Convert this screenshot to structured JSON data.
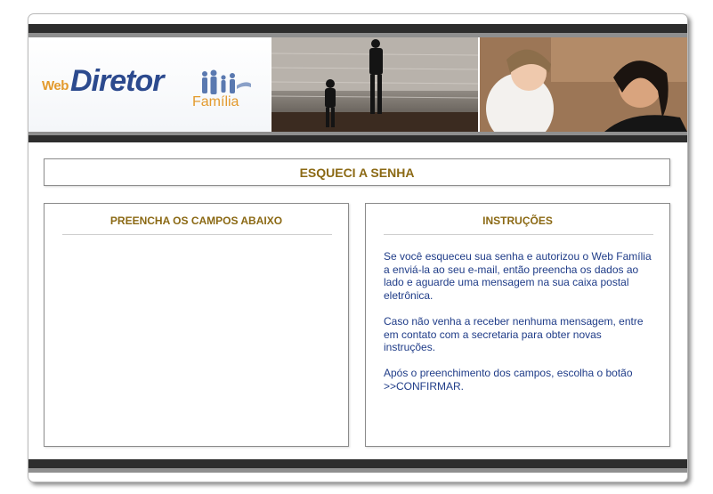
{
  "logo": {
    "web": "Web",
    "diretor": "Diretor",
    "familia": "Família"
  },
  "page_title": "ESQUECI A SENHA",
  "form_panel": {
    "title": "PREENCHA OS CAMPOS ABAIXO"
  },
  "instructions_panel": {
    "title": "INSTRUÇÕES",
    "paragraphs": [
      "Se você esqueceu sua senha e autorizou o Web Família a enviá-la ao seu e-mail, então preencha os dados ao lado e aguarde uma mensagem na sua caixa postal eletrônica.",
      "Caso não venha a receber nenhuma mensagem, entre em contato com a secretaria para obter novas instruções.",
      "Após o preenchimento dos campos, escolha o botão >>CONFIRMAR."
    ]
  },
  "colors": {
    "heading": "#8b6914",
    "body_text": "#1f3c88",
    "bar_dark": "#2d2d2d",
    "bar_gray": "#8f8f8f"
  }
}
